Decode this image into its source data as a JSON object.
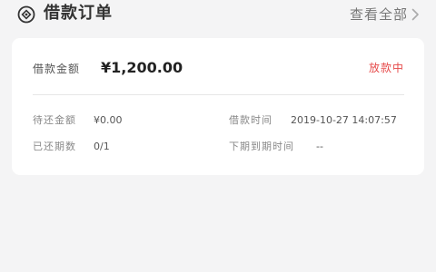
{
  "header": {
    "title": "借款订单",
    "view_all_label": "查看全部"
  },
  "order": {
    "amount_label": "借款金额",
    "amount_value": "¥1,200.00",
    "status": "放款中",
    "details": {
      "pending_repay_label": "待还金额",
      "pending_repay_value": "¥0.00",
      "loan_time_label": "借款时间",
      "loan_time_value": "2019-10-27 14:07:57",
      "repaid_periods_label": "已还期数",
      "repaid_periods_value": "0/1",
      "next_due_label": "下期到期时间",
      "next_due_value": "--"
    }
  },
  "colors": {
    "status": "#e64a4a",
    "background": "#f4f4f5",
    "card": "#ffffff"
  },
  "icons": {
    "header": "target-circle-icon",
    "view_all": "chevron-right-icon"
  }
}
